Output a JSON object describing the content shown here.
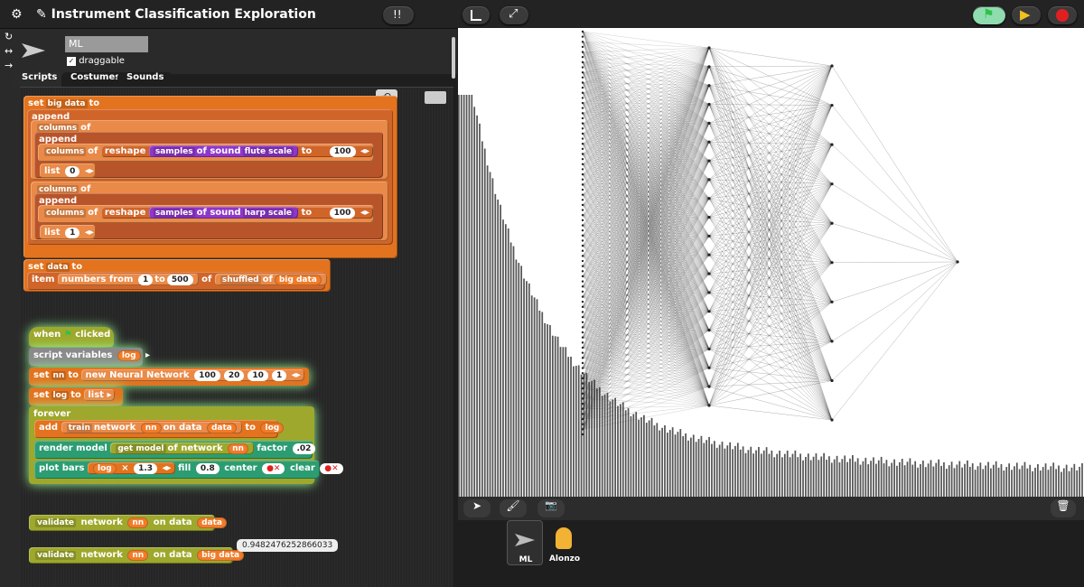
{
  "project": {
    "title": "Instrument Classification Exploration"
  },
  "sprite": {
    "name": "ML",
    "draggable_label": "draggable"
  },
  "tabs": [
    "Scripts",
    "Costumes",
    "Sounds"
  ],
  "blocks": {
    "set": "set",
    "to": "to",
    "append": "append",
    "columns": "columns",
    "of": "of",
    "reshape": "reshape",
    "samples": "samples",
    "of_sound": "of sound",
    "flute_scale": "flute scale",
    "harp_scale": "harp scale",
    "hundred": "100",
    "list": "list",
    "zero": "0",
    "one": "1",
    "big_data": "big data",
    "data": "data",
    "item": "item",
    "numbers_from": "numbers from",
    "n1": "1",
    "n500": "500",
    "shuffled": "shuffled",
    "when": "when",
    "clicked": "clicked",
    "script_variables": "script variables",
    "log": "log",
    "nn": "nn",
    "new_nn": "new Neural Network",
    "l1": "100",
    "l2": "20",
    "l3": "10",
    "l4": "1",
    "forever": "forever",
    "add": "add",
    "train": "train",
    "network": "network",
    "on_data": "on data",
    "render_model": "render model",
    "get_model": "get model",
    "of_network": "of network",
    "factor": "factor",
    "factor_val": ".02",
    "plot_bars": "plot bars",
    "times": "×",
    "scale": "1.3",
    "fill": "fill",
    "fill_val": "0.8",
    "center": "center",
    "clear": "clear",
    "validate": "validate",
    "result": "0.9482476252866033"
  },
  "corral": {
    "sprites": [
      "ML",
      "Alonzo"
    ]
  },
  "colors": {
    "stage_bg": "#ffffff",
    "bars": "#555555",
    "green_flag": "#2ec24a",
    "stop": "#e02020",
    "pause": "#f0c020"
  },
  "stage": {
    "network_layers": [
      80,
      20,
      10,
      1
    ]
  }
}
